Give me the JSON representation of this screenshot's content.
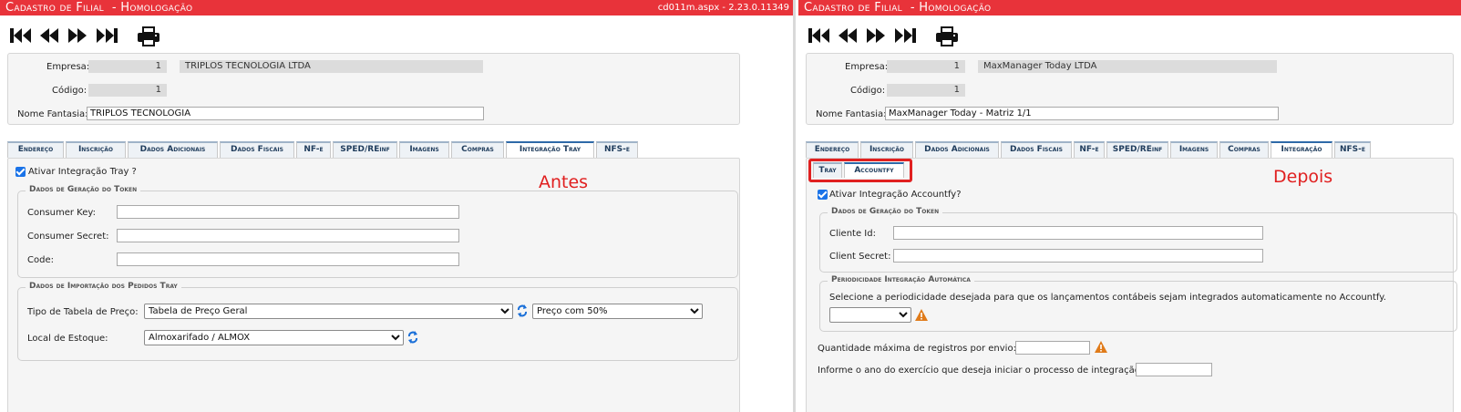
{
  "left": {
    "title": "Cadastro de Filial  - Homologação",
    "version": "cd011m.aspx - 2.23.0.11349",
    "header": {
      "empresa_label": "Empresa:",
      "empresa_code": "1",
      "empresa_name": "TRIPLOS TECNOLOGIA LTDA",
      "codigo_label": "Código:",
      "codigo_value": "1",
      "nome_label": "Nome Fantasia:",
      "nome_value": "TRIPLOS TECNOLOGIA"
    },
    "tabs": [
      "Endereço",
      "Inscrição",
      "Dados Adicionais",
      "Dados Fiscais",
      "NF-e",
      "SPED/REinf",
      "Imagens",
      "Compras",
      "Integração Tray",
      "NFS-e"
    ],
    "active_tab": "Integração Tray",
    "annotation": "Antes",
    "checkbox_label": "Ativar Integração Tray ?",
    "token_legend": "Dados de Geração do Token",
    "consumer_key_label": "Consumer Key:",
    "consumer_secret_label": "Consumer Secret:",
    "code_label": "Code:",
    "import_legend": "Dados de Importação dos Pedidos Tray",
    "tipo_label": "Tipo de Tabela de Preço:",
    "tipo_value": "Tabela de Preço Geral",
    "preco_value": "Preço com 50%",
    "local_label": "Local de Estoque:",
    "local_value": "Almoxarifado / ALMOX"
  },
  "right": {
    "title": "Cadastro de Filial  - Homologação",
    "header": {
      "empresa_label": "Empresa:",
      "empresa_code": "1",
      "empresa_name": "MaxManager Today LTDA",
      "codigo_label": "Código:",
      "codigo_value": "1",
      "nome_label": "Nome Fantasia:",
      "nome_value": "MaxManager Today - Matriz 1/1"
    },
    "tabs": [
      "Endereço",
      "Inscrição",
      "Dados Adicionais",
      "Dados Fiscais",
      "NF-e",
      "SPED/REinf",
      "Imagens",
      "Compras",
      "Integração",
      "NFS-e"
    ],
    "active_tab": "Integração",
    "subtabs": [
      "Tray",
      "Accountfy"
    ],
    "active_subtab": "Accountfy",
    "annotation": "Depois",
    "checkbox_label": "Ativar Integração Accountfy?",
    "token_legend": "Dados de Geração do Token",
    "cliente_id_label": "Cliente Id:",
    "client_secret_label": "Client Secret:",
    "period_legend": "Periodicidade Integração Automática",
    "period_text": "Selecione a periodicidade desejada para que os lançamentos contábeis sejam integrados automaticamente no Accountfy.",
    "qtd_label": "Quantidade máxima de registros por envio:",
    "ano_label": "Informe o ano do exercício que deseja iniciar o processo de integração:"
  },
  "colors": {
    "titlebar": "#e8333a",
    "annotation": "#e02020",
    "tab_active_border": "#2e6aa8",
    "warning": "#e07b1a",
    "refresh": "#1a6fd8"
  },
  "icons": [
    "first-record-icon",
    "previous-record-icon",
    "next-record-icon",
    "last-record-icon",
    "print-icon",
    "refresh-icon",
    "warning-icon"
  ]
}
